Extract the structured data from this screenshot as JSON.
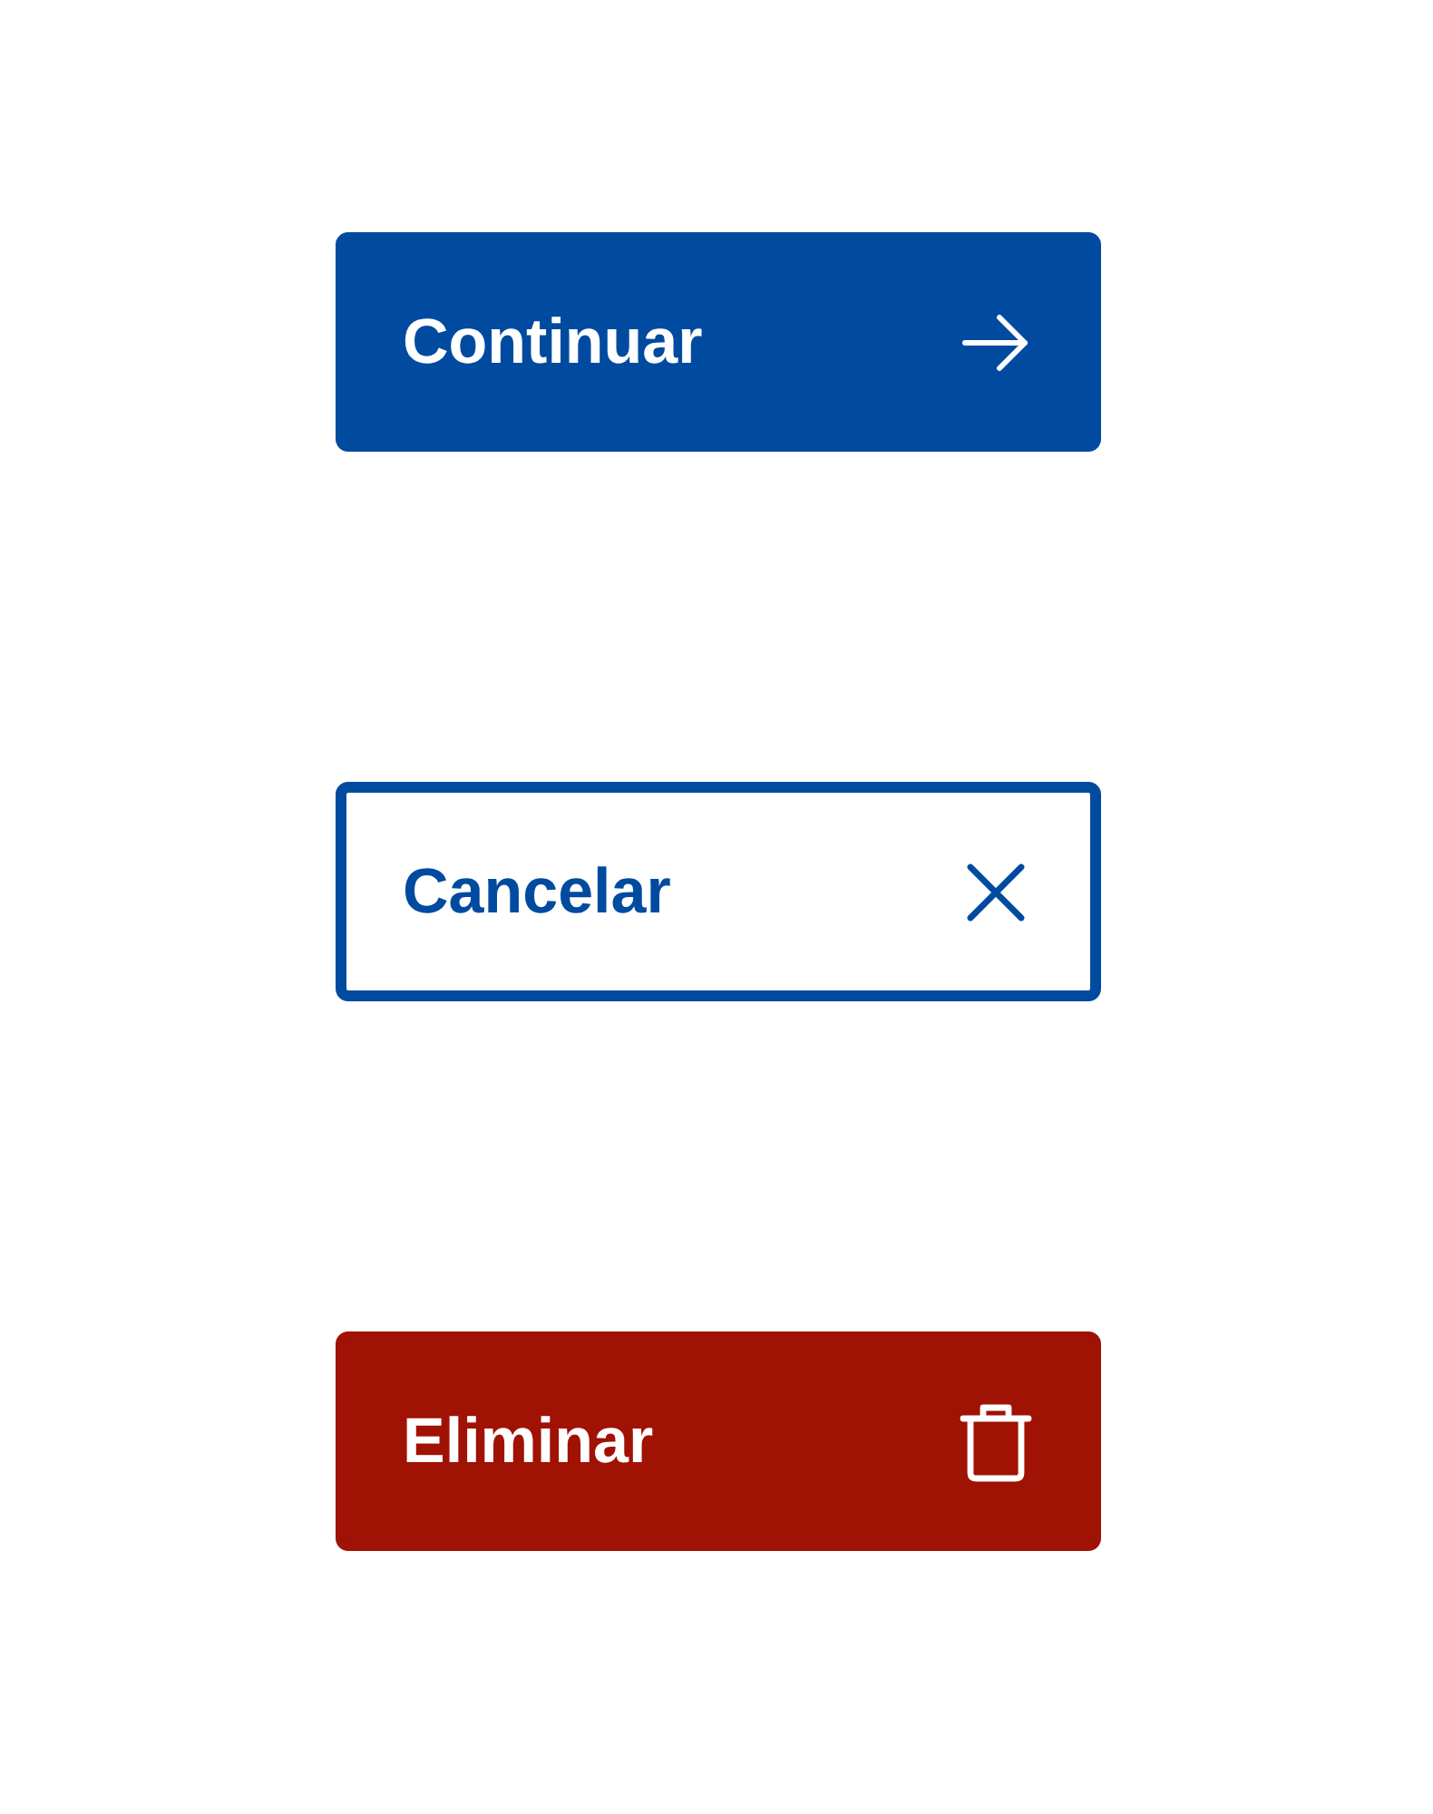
{
  "buttons": [
    {
      "kind": "primary",
      "label": "Continuar"
    },
    {
      "kind": "outline",
      "label": "Cancelar"
    },
    {
      "kind": "danger",
      "label": "Eliminar"
    }
  ]
}
